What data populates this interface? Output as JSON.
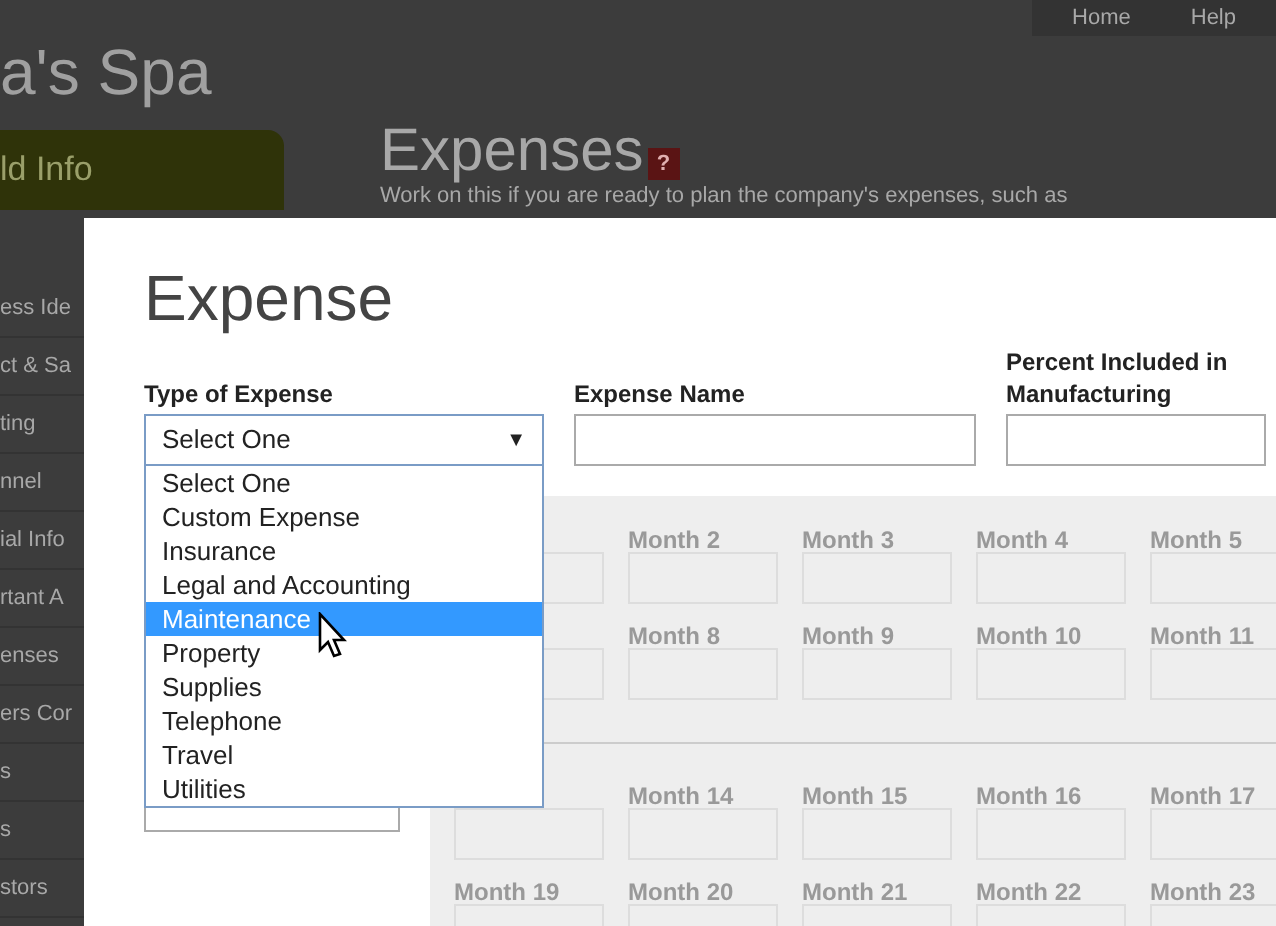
{
  "background_page": {
    "nav": [
      "Home",
      "Help"
    ],
    "brand": "a's Spa",
    "sidebar_button": "ld Info",
    "sidebar_items": [
      "ess Ide",
      "ct & Sa",
      "ting",
      "nnel",
      "ial Info",
      "rtant A",
      "enses",
      "ers Cor",
      "s",
      "s",
      "stors"
    ],
    "heading": "Expenses",
    "help_badge": "?",
    "intro": "Work on this if you are ready to plan the company's expenses, such as"
  },
  "dialog": {
    "title": "Expense",
    "fields": [
      {
        "kind": "select",
        "label": "Type of Expense",
        "value": "Select One",
        "caret": "▼",
        "expanded": true
      },
      {
        "kind": "text",
        "label": "Expense Name"
      },
      {
        "kind": "text",
        "label": "Percent Included in Manufacturing"
      }
    ],
    "dropdown_options": [
      {
        "label": "Select One",
        "selected": false
      },
      {
        "label": "Custom Expense",
        "selected": false
      },
      {
        "label": "Insurance",
        "selected": false
      },
      {
        "label": "Legal and Accounting",
        "selected": false
      },
      {
        "label": "Maintenance",
        "selected": true
      },
      {
        "label": "Property",
        "selected": false
      },
      {
        "label": "Supplies",
        "selected": false
      },
      {
        "label": "Telephone",
        "selected": false
      },
      {
        "label": "Travel",
        "selected": false
      },
      {
        "label": "Utilities",
        "selected": false
      }
    ],
    "month_groups": [
      [
        {
          "months": [
            "Month 2",
            "Month 3",
            "Month 4",
            "Month 5"
          ]
        },
        {
          "months": [
            "Month 8",
            "Month 9",
            "Month 10",
            "Month 11"
          ]
        }
      ],
      [
        {
          "months": [
            "Month 14",
            "Month 15",
            "Month 16",
            "Month 17"
          ]
        },
        {
          "first": "Month 19",
          "months": [
            "Month 20",
            "Month 21",
            "Month 22",
            "Month 23"
          ]
        }
      ]
    ]
  }
}
